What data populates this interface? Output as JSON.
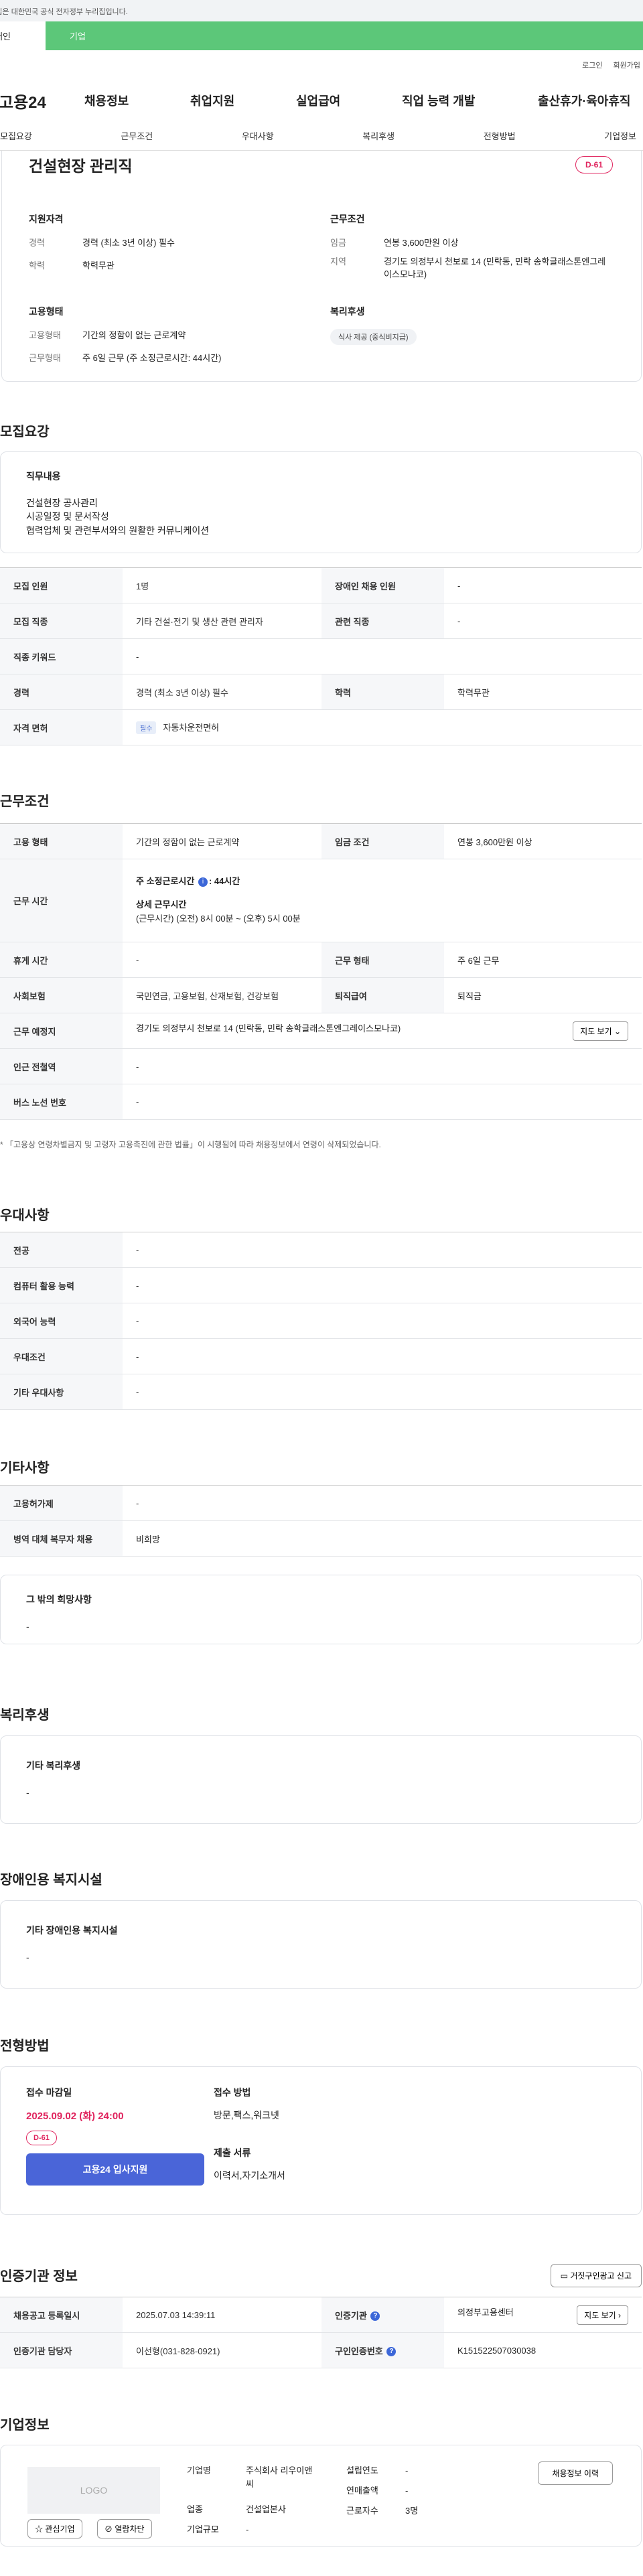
{
  "gov_notice": "이 누리집은 대한민국 공식 전자정부 누리집입니다.",
  "top_tabs": {
    "person": "개인",
    "business": "기업"
  },
  "util": {
    "login": "로그인",
    "signup": "회원가입"
  },
  "gnb": {
    "logo": "고용24",
    "items": [
      "채용정보",
      "취업지원",
      "실업급여",
      "직업 능력 개발",
      "출산휴가·육아휴직"
    ]
  },
  "anchor_tabs": [
    "모집요강",
    "근무조건",
    "우대사항",
    "복리후생",
    "전형방법",
    "기업정보"
  ],
  "job": {
    "title": "건설현장 관리직",
    "dday": "D-61",
    "qual": {
      "heading": "지원자격",
      "rows": [
        {
          "k": "경력",
          "v": "경력 (최소 3년 이상) 필수"
        },
        {
          "k": "학력",
          "v": "학력무관"
        }
      ]
    },
    "cond": {
      "heading": "근무조건",
      "rows": [
        {
          "k": "임금",
          "v": "연봉 3,600만원 이상"
        },
        {
          "k": "지역",
          "v": "경기도 의정부시 천보로 14 (민락동, 민락 송학글래스톤엔그레이스모나코)"
        }
      ]
    },
    "emp": {
      "heading": "고용형태",
      "rows": [
        {
          "k": "고용형태",
          "v": "기간의 정함이 없는 근로계약"
        },
        {
          "k": "근무형태",
          "v": "주 6일 근무 (주 소정근로시간: 44시간)"
        }
      ]
    },
    "welfare": {
      "heading": "복리후생",
      "chip": "식사 제공 (중식비지급)"
    }
  },
  "recruit": {
    "title": "모집요강",
    "duty_heading": "직무내용",
    "duty_lines": [
      "건설현장 공사관리",
      "시공일정 및 문서작성",
      "협력업체 및 관련부서와의 원활한 커뮤니케이션"
    ],
    "table": {
      "headcount_k": "모집 인원",
      "headcount_v": "1명",
      "disabled_k": "장애인 채용 인원",
      "disabled_v": "-",
      "job_k": "모집 직종",
      "job_v": "기타 건설·전기 및 생산 관련 관리자",
      "related_k": "관련 직종",
      "related_v": "-",
      "keyword_k": "직종 키워드",
      "keyword_v": "-",
      "career_k": "경력",
      "career_v": "경력 (최소 3년 이상) 필수",
      "edu_k": "학력",
      "edu_v": "학력무관",
      "license_k": "자격 면허",
      "license_badge": "필수",
      "license_v": "자동차운전면허"
    }
  },
  "work": {
    "title": "근무조건",
    "table": {
      "emp_k": "고용 형태",
      "emp_v": "기간의 정함이 없는 근로계약",
      "wage_k": "임금 조건",
      "wage_v": "연봉 3,600만원 이상",
      "hours_k": "근무 시간",
      "hours_line1": "주 소정근로시간",
      "hours_line1_val": ": 44시간",
      "hours_line2": "상세 근무시간",
      "hours_line3": "(근무시간) (오전) 8시 00분 ~ (오후) 5시 00분",
      "break_k": "휴게 시간",
      "break_v": "-",
      "form_k": "근무 형태",
      "form_v": "주 6일 근무",
      "insurance_k": "사회보험",
      "insurance_v": "국민연금, 고용보험, 산재보험, 건강보험",
      "severance_k": "퇴직급여",
      "severance_v": "퇴직금",
      "place_k": "근무 예정지",
      "place_v": "경기도 의정부시 천보로 14 (민락동, 민락 송학글래스톤엔그레이스모나코)",
      "map_btn": "지도 보기",
      "subway_k": "인근 전철역",
      "subway_v": "-",
      "bus_k": "버스 노선 번호",
      "bus_v": "-"
    },
    "note": "* 「고용상 연령차별금지 및 고령자 고용촉진에 관한 법률」이 시행됨에 따라 채용정보에서 연령이 삭제되었습니다."
  },
  "pref": {
    "title": "우대사항",
    "rows": [
      {
        "k": "전공",
        "v": "-"
      },
      {
        "k": "컴퓨터 활용 능력",
        "v": "-"
      },
      {
        "k": "외국어 능력",
        "v": "-"
      },
      {
        "k": "우대조건",
        "v": "-"
      },
      {
        "k": "기타 우대사항",
        "v": "-"
      }
    ]
  },
  "etc": {
    "title": "기타사항",
    "rows": [
      {
        "k": "고용허가제",
        "v": "-"
      },
      {
        "k": "병역 대체 복무자 채용",
        "v": "비희망"
      }
    ],
    "box_heading": "그 밖의 희망사항",
    "box_value": "-"
  },
  "benefits": {
    "title": "복리후생",
    "heading": "기타 복리후생",
    "value": "-"
  },
  "facility": {
    "title": "장애인용 복지시설",
    "heading": "기타 장애인용 복지시설",
    "value": "-"
  },
  "process": {
    "title": "전형방법",
    "deadline_h": "접수 마감일",
    "deadline_v": "2025.09.02 (화) 24:00",
    "dday": "D-61",
    "apply_btn": "고용24 입사지원",
    "method_h": "접수 방법",
    "method_v": "방문,팩스,워크넷",
    "docs_h": "제출 서류",
    "docs_v": "이력서,자기소개서"
  },
  "cert": {
    "title": "인증기관 정보",
    "report_btn": "거짓구인광고 신고",
    "reg_k": "채용공고 등록일시",
    "reg_v": "2025.07.03 14:39:11",
    "org_k": "인증기관",
    "org_v": "의정부고용센터",
    "mgr_k": "인증기관 담당자",
    "mgr_v": "이선형(031-828-0921)",
    "num_k": "구인인증번호",
    "num_v": "K151522507030038",
    "map_btn": "지도 보기"
  },
  "company": {
    "title": "기업정보",
    "logo": "LOGO",
    "fav_btn": "관심기업",
    "block_btn": "열람차단",
    "name_k": "기업명",
    "name_v": "주식회사 리우이앤씨",
    "ind_k": "업종",
    "ind_v": "건설업본사",
    "size_k": "기업규모",
    "size_v": "-",
    "year_k": "설립연도",
    "year_v": "-",
    "sales_k": "연매출액",
    "sales_v": "-",
    "emp_k": "근로자수",
    "emp_v": "3명",
    "history_btn": "채용정보 이력"
  }
}
